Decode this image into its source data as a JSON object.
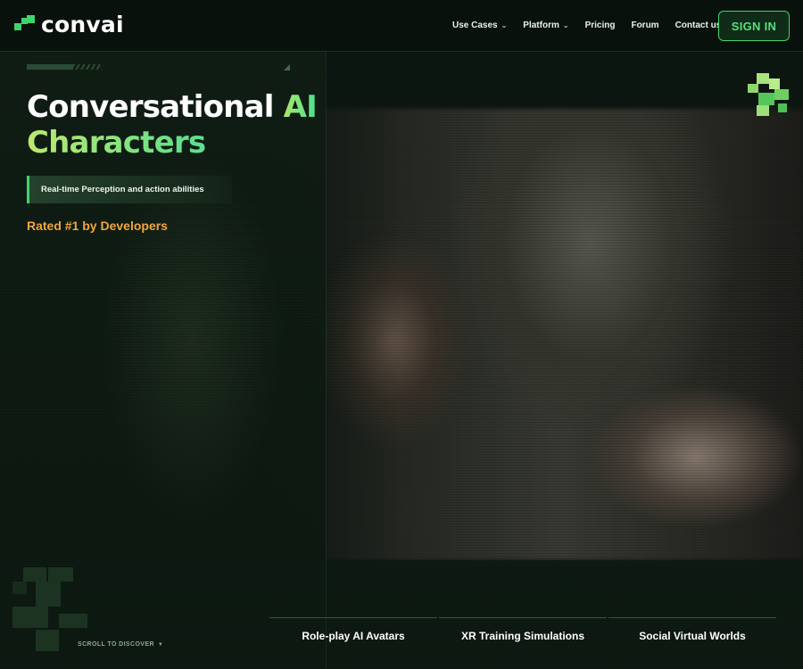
{
  "header": {
    "logo_text": "convai",
    "nav": [
      {
        "label": "Use Cases",
        "has_dropdown": true
      },
      {
        "label": "Platform",
        "has_dropdown": true
      },
      {
        "label": "Pricing",
        "has_dropdown": false
      },
      {
        "label": "Forum",
        "has_dropdown": false
      },
      {
        "label": "Contact us",
        "has_dropdown": false
      }
    ],
    "signin_label": "SIGN IN"
  },
  "hero": {
    "headline_part1": "Conversational ",
    "headline_accent": "AI",
    "headline_line2": "Characters",
    "tagline": "Real-time Perception and action abilities",
    "rated": "Rated #1 by Developers",
    "scroll_label": "SCROLL TO DISCOVER"
  },
  "use_cases": [
    {
      "label": "Role-play AI Avatars"
    },
    {
      "label": "XR Training Simulations"
    },
    {
      "label": "Social Virtual Worlds"
    }
  ],
  "colors": {
    "accent_green": "#3fd46a",
    "rated_orange": "#f0a63b",
    "background": "#0c1811"
  },
  "icons": {
    "dropdown": "chevron-down-icon",
    "logo": "convai-logo-icon"
  }
}
